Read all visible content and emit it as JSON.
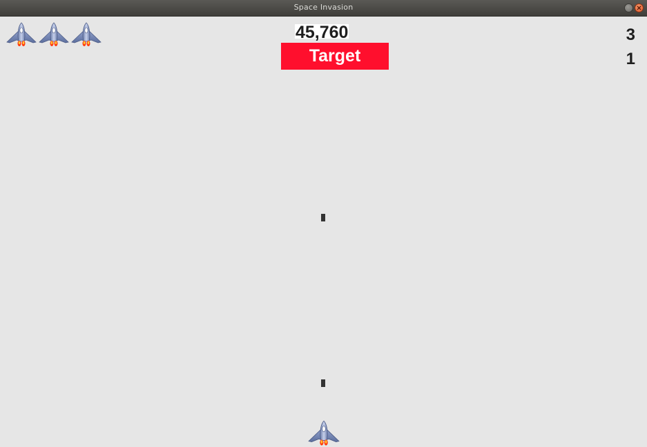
{
  "window": {
    "title": "Space Invasion"
  },
  "hud": {
    "lives_remaining": 3,
    "score": "45,760",
    "target_label": "Target",
    "right_top_value": "3",
    "right_bottom_value": "1"
  },
  "colors": {
    "background": "#e6e6e6",
    "target_banner": "#ff0f2d",
    "bullet": "#333333",
    "ship_body": "#7d8fbf",
    "flame": "#ff3a10"
  },
  "icons": {
    "life": "player-ship-icon",
    "player": "player-ship-icon",
    "projectile": "bullet"
  }
}
